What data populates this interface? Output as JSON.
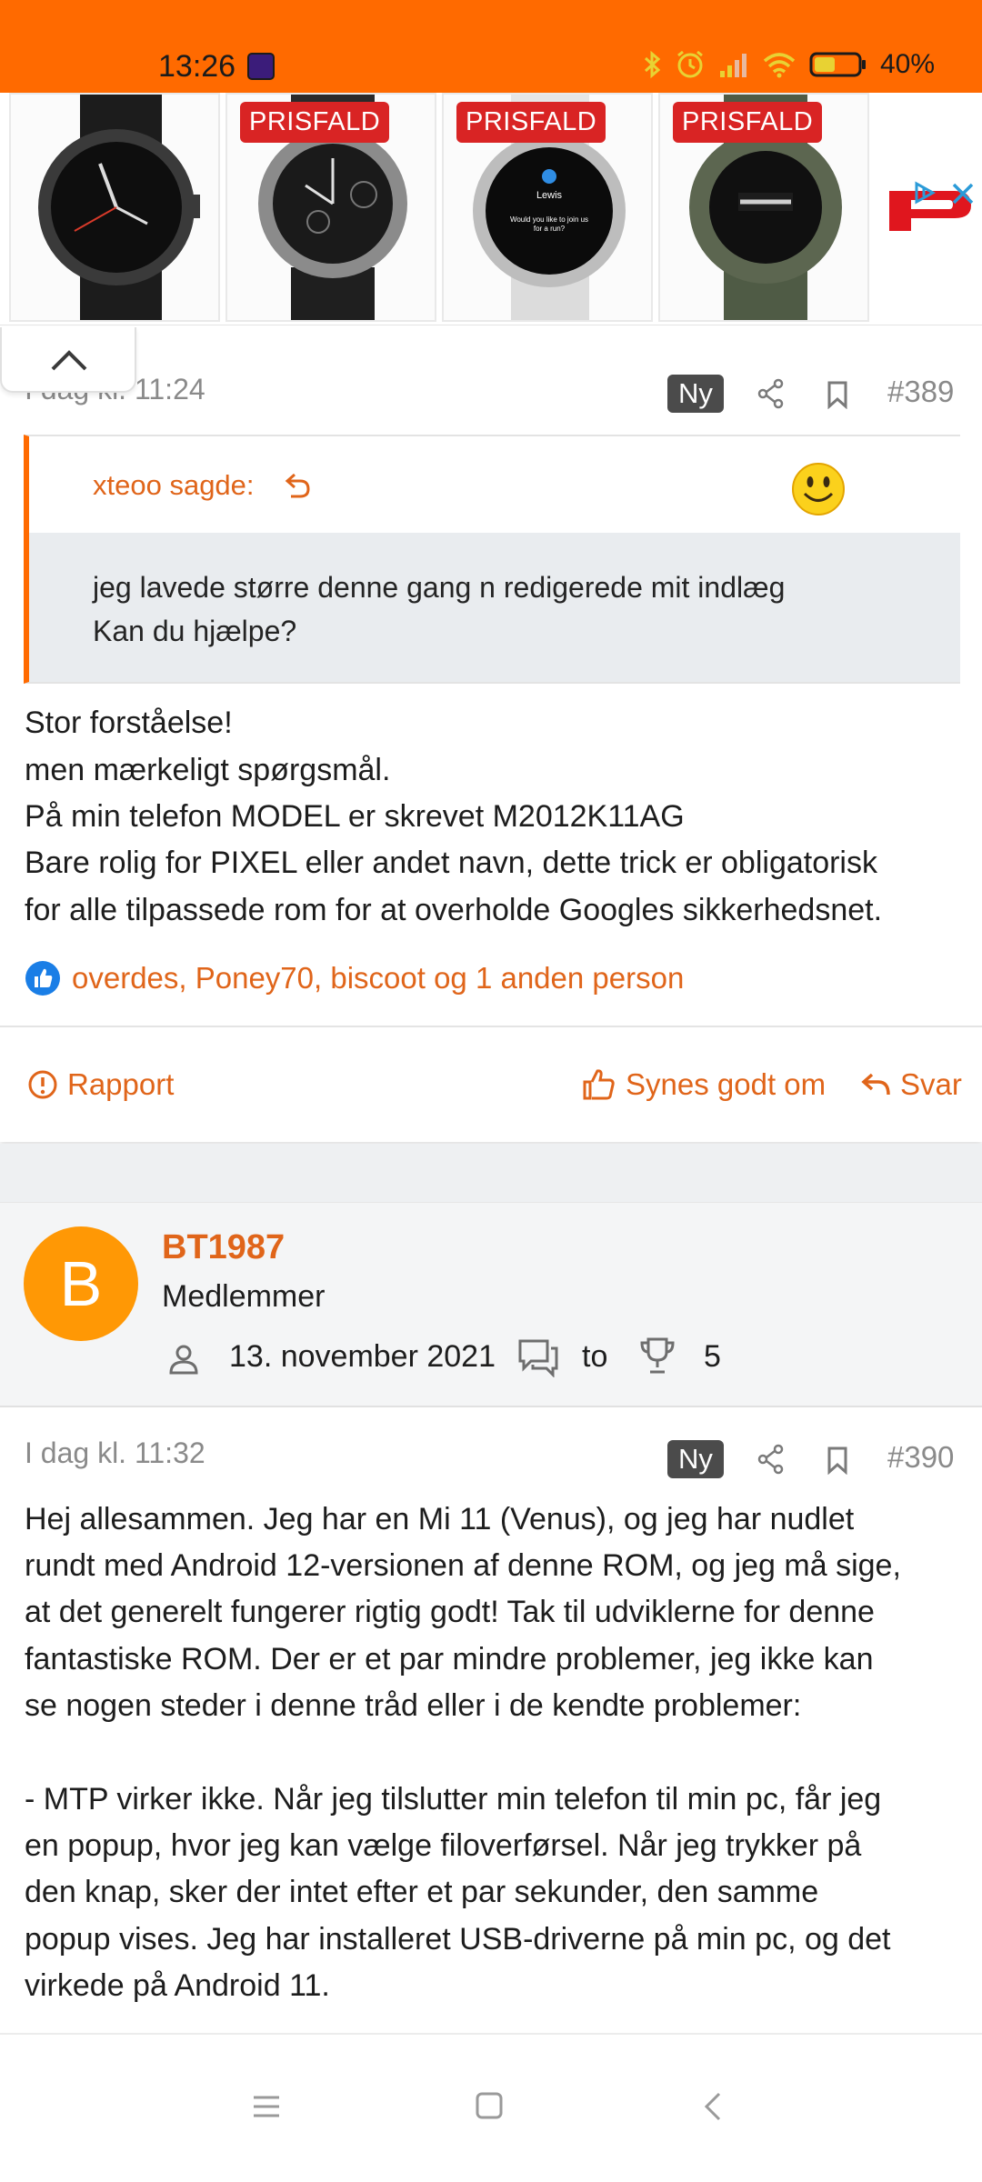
{
  "status_bar": {
    "time": "13:26",
    "battery": "40%",
    "accent": "#ff6a00"
  },
  "ad": {
    "items": [
      {
        "badge": ""
      },
      {
        "badge": "PRISFALD"
      },
      {
        "badge": "PRISFALD",
        "screen_name": "Lewis",
        "screen_text_1": "Would you like to join us",
        "screen_text_2": "for a run?"
      },
      {
        "badge": "PRISFALD"
      }
    ],
    "info_icon": "adchoices-icon",
    "close_icon": "close-icon"
  },
  "post_389": {
    "date": "I dag kl. 11:24",
    "new_badge": "Ny",
    "number": "#389",
    "quote": {
      "author": "xteoo sagde:",
      "line1": "jeg lavede større denne gang n redigerede mit indlæg",
      "line2": "Kan du hjælpe?"
    },
    "body": [
      "Stor forståelse!",
      "men mærkeligt spørgsmål.",
      "På min telefon MODEL er skrevet M2012K11AG",
      "Bare rolig for PIXEL eller andet navn, dette trick er obligatorisk",
      "for alle tilpassede rom for at overholde Googles sikkerhedsnet."
    ],
    "likes": "overdes, Poney70, biscoot og 1 anden person",
    "actions": {
      "report": "Rapport",
      "like": "Synes godt om",
      "reply": "Svar"
    }
  },
  "user_390": {
    "avatar_letter": "B",
    "name": "BT1987",
    "title": "Medlemmer",
    "joined": "13. november 2021",
    "messages": "to",
    "points": "5"
  },
  "post_390": {
    "date": "I dag kl. 11:32",
    "new_badge": "Ny",
    "number": "#390",
    "body": [
      "Hej allesammen. Jeg har en Mi 11 (Venus), og jeg har nudlet",
      "rundt med Android 12-versionen af denne ROM, og jeg må sige,",
      "at det generelt fungerer rigtig godt! Tak til udviklerne for denne",
      "fantastiske ROM. Der er et par mindre problemer, jeg ikke kan",
      "se nogen steder i denne tråd eller i de kendte problemer:",
      "",
      "- MTP virker ikke. Når jeg tilslutter min telefon til min pc, får jeg",
      "en popup, hvor jeg kan vælge filoverførsel. Når jeg trykker på",
      "den knap, sker der intet efter et par sekunder, den samme",
      "popup vises. Jeg har installeret USB-driverne på min pc, og det",
      "virkede på Android 11."
    ]
  },
  "colors": {
    "link": "#e0651a",
    "badge_bg": "#4b4b4b",
    "quote_bg": "#e9ecef",
    "avatar_bg": "#ff9805",
    "like_blue": "#1a7ee6"
  }
}
